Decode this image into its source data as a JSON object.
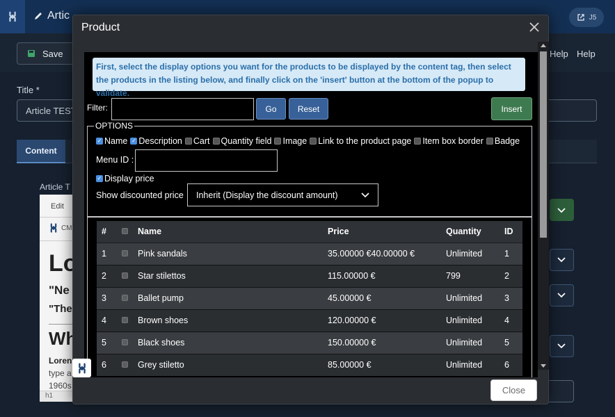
{
  "background": {
    "page_title": "Artic",
    "top_button_label": "J5",
    "save_label": "Save",
    "help_labels": [
      "Help",
      "Help"
    ],
    "title_label": "Title *",
    "title_value": "Article TEST",
    "tab_content_label": "Content",
    "article_text_label": "Article T",
    "editor": {
      "menu_label": "Edit",
      "cm_label": "CM",
      "heading_large": "Lo",
      "quote1": "\"Ne",
      "quote2": "\"The",
      "heading_wh": "Wh",
      "para1": "Loren",
      "para2": "type a",
      "para3": "1960s",
      "footer": "h1"
    }
  },
  "modal": {
    "title": "Product",
    "close_label": "Close",
    "info_text": "First, select the display options you want for the products to be displayed by the content tag, then select the  products in the listing below, and finally click on the 'insert' button at the bottom of the popup to validate.",
    "filter_label": "Filter:",
    "filter_value": "",
    "go_label": "Go",
    "reset_label": "Reset",
    "insert_label": "Insert",
    "options_legend": "OPTIONS",
    "options": [
      {
        "label": "Name",
        "checked": true
      },
      {
        "label": "Description",
        "checked": true
      },
      {
        "label": "Cart",
        "checked": false
      },
      {
        "label": "Quantity field",
        "checked": false
      },
      {
        "label": "Image",
        "checked": false
      },
      {
        "label": "Link to the product page",
        "checked": false
      },
      {
        "label": "Item box border",
        "checked": false
      },
      {
        "label": "Badge",
        "checked": false
      }
    ],
    "menu_id_label": "Menu ID :",
    "display_price_label": "Display price",
    "display_price_checked": true,
    "discount_label": "Show discounted price",
    "discount_value": "Inherit (Display the discount amount)",
    "table": {
      "headers": [
        "#",
        "",
        "Name",
        "Price",
        "Quantity",
        "ID"
      ],
      "rows": [
        {
          "num": "1",
          "name": "Pink sandals",
          "price": "35.00000 €40.00000 €",
          "quantity": "Unlimited",
          "id": "1"
        },
        {
          "num": "2",
          "name": "Star stilettos",
          "price": "115.00000 €",
          "quantity": "799",
          "id": "2"
        },
        {
          "num": "3",
          "name": "Ballet pump",
          "price": "45.00000 €",
          "quantity": "Unlimited",
          "id": "3"
        },
        {
          "num": "4",
          "name": "Brown shoes",
          "price": "120.00000 €",
          "quantity": "Unlimited",
          "id": "4"
        },
        {
          "num": "5",
          "name": "Black shoes",
          "price": "150.00000 €",
          "quantity": "Unlimited",
          "id": "5"
        },
        {
          "num": "6",
          "name": "Grey stiletto",
          "price": "85.00000 €",
          "quantity": "Unlimited",
          "id": "6"
        }
      ]
    }
  },
  "colors": {
    "topbar": "#132f53",
    "modal_bg": "#2a2d31",
    "info_bg": "#d6e9f7",
    "info_text": "#2b6fa9",
    "primary_btn": "#376198",
    "insert_btn": "#3e7a4f"
  }
}
